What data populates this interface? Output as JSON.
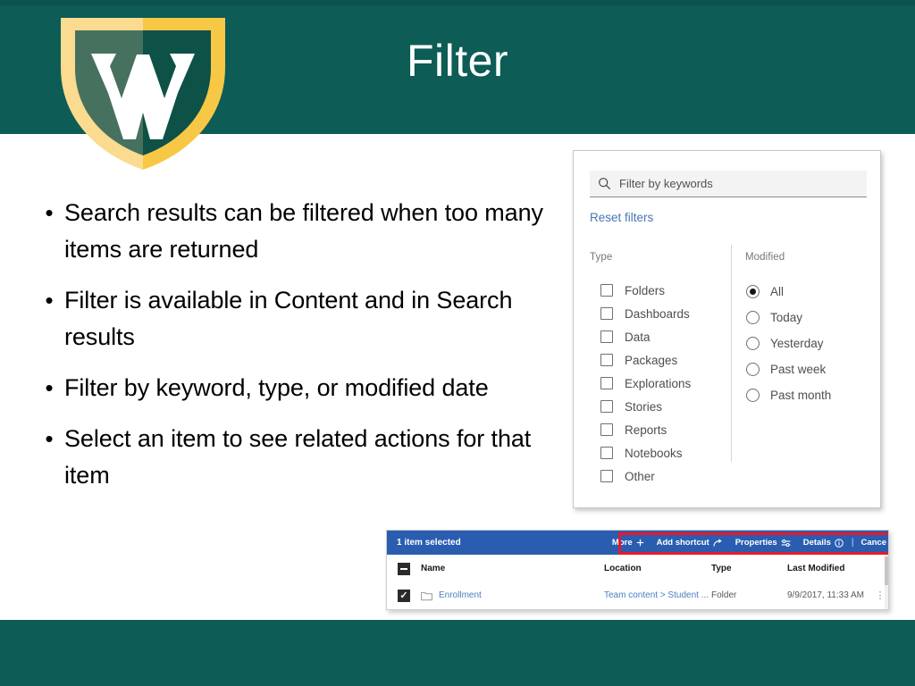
{
  "slide": {
    "title": "Filter",
    "brand_teal": "#0d5c55",
    "brand_gold": "#f5c242",
    "logo_name": "wayne-state-w-shield-logo"
  },
  "bullets": [
    {
      "marker": "•",
      "text": "Search results can be filtered when too many items are returned"
    },
    {
      "marker": "•",
      "text": "Filter is available in Content and in Search results"
    },
    {
      "marker": "•",
      "text": "Filter by keyword, type, or modified date"
    },
    {
      "marker": "•",
      "text": "Select an item to see related actions for that item"
    }
  ],
  "filter_panel": {
    "search_placeholder": "Filter by keywords",
    "reset_label": "Reset filters",
    "type": {
      "heading": "Type",
      "options": [
        {
          "label": "Folders",
          "checked": false
        },
        {
          "label": "Dashboards",
          "checked": false
        },
        {
          "label": "Data",
          "checked": false
        },
        {
          "label": "Packages",
          "checked": false
        },
        {
          "label": "Explorations",
          "checked": false
        },
        {
          "label": "Stories",
          "checked": false
        },
        {
          "label": "Reports",
          "checked": false
        },
        {
          "label": "Notebooks",
          "checked": false
        },
        {
          "label": "Other",
          "checked": false
        }
      ]
    },
    "modified": {
      "heading": "Modified",
      "selected": "All",
      "options": [
        {
          "label": "All",
          "checked": true
        },
        {
          "label": "Today",
          "checked": false
        },
        {
          "label": "Yesterday",
          "checked": false
        },
        {
          "label": "Past week",
          "checked": false
        },
        {
          "label": "Past month",
          "checked": false
        }
      ]
    }
  },
  "list_panel": {
    "selection_text": "1 item selected",
    "actions": [
      {
        "label": "More",
        "icon": "plus-icon"
      },
      {
        "label": "Add shortcut",
        "icon": "shortcut-arrow-icon"
      },
      {
        "label": "Properties",
        "icon": "properties-sliders-icon"
      },
      {
        "label": "Details",
        "icon": "info-circle-icon"
      }
    ],
    "separator": "|",
    "cancel_label": "Cance",
    "columns": [
      "Name",
      "Location",
      "Type",
      "Last Modified"
    ],
    "rows": [
      {
        "checked": true,
        "name": "Enrollment",
        "location": "Team content > Student ...",
        "type": "Folder",
        "last_modified": "9/9/2017, 11:33 AM",
        "kebab": "⋮"
      }
    ],
    "highlight_color": "#e8192c"
  }
}
